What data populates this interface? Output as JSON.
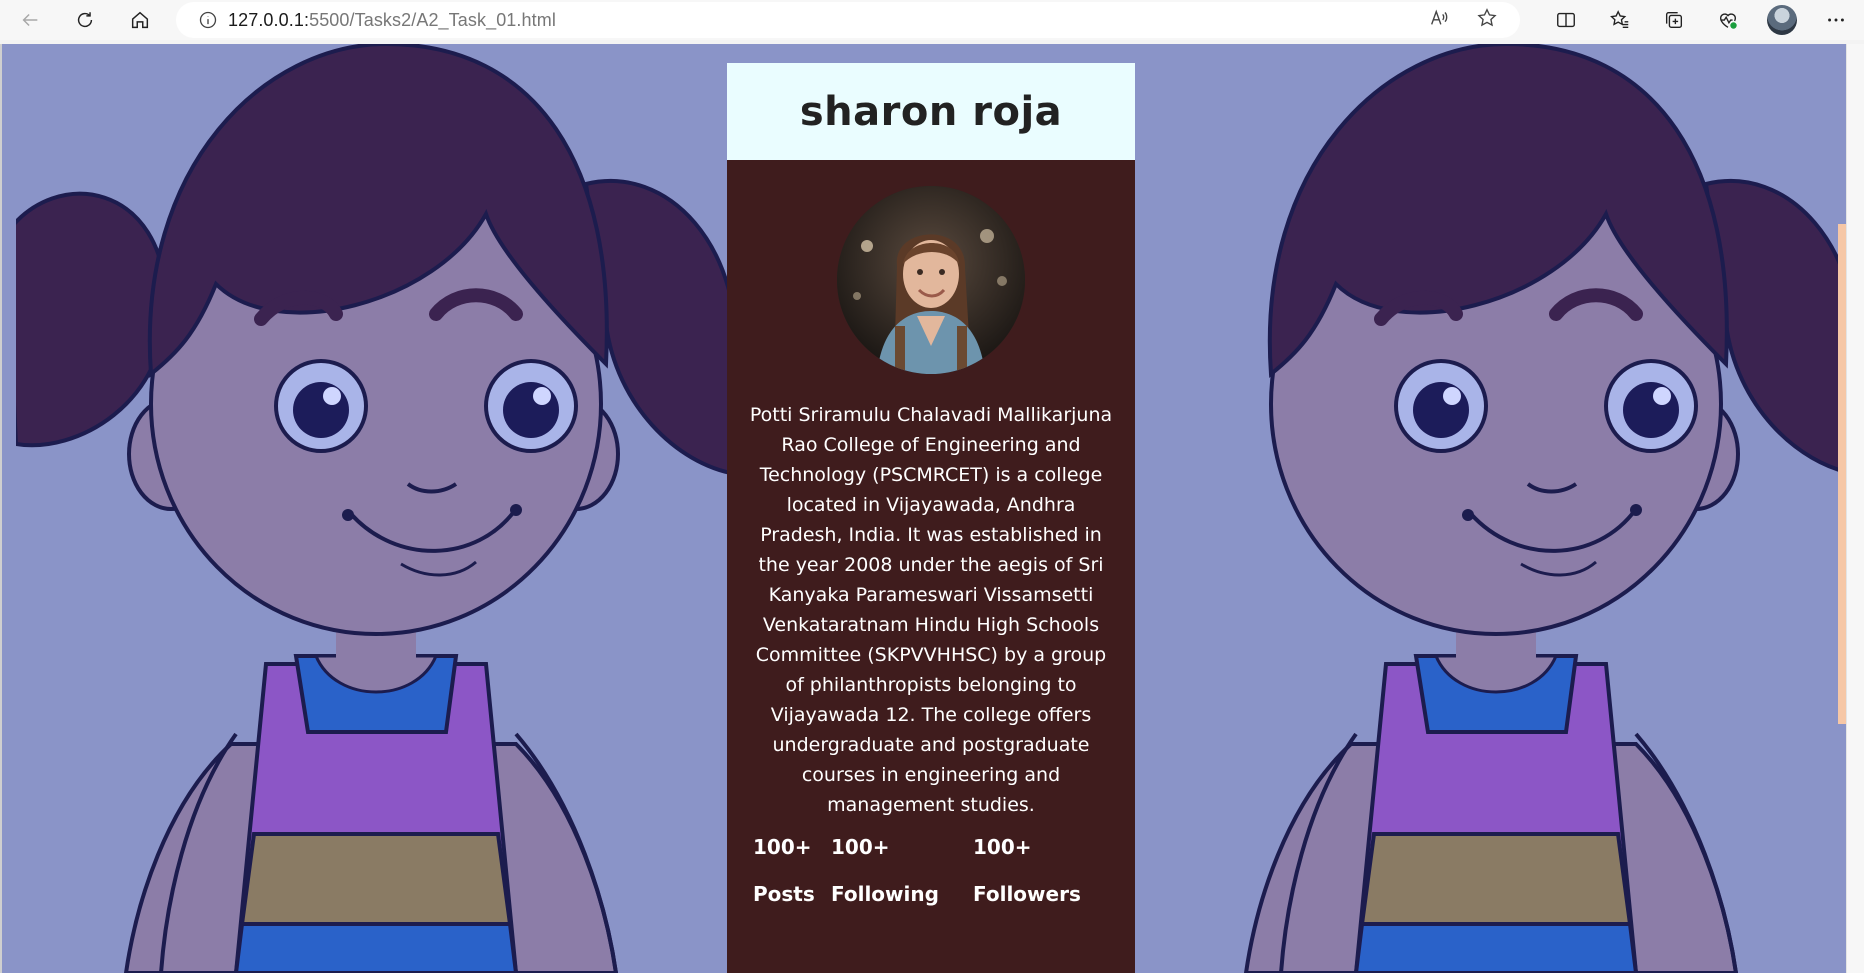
{
  "browser": {
    "url_host": "127.0.0.1:",
    "url_rest": "5500/Tasks2/A2_Task_01.html",
    "icons": [
      "back-icon",
      "refresh-icon",
      "home-icon",
      "info-icon",
      "read-aloud-icon",
      "favorite-star-icon",
      "split-screen-icon",
      "favorites-icon",
      "collections-icon",
      "browser-essentials-icon",
      "profile-avatar",
      "more-icon"
    ]
  },
  "profile": {
    "name": "sharon roja",
    "bio": "Potti Sriramulu Chalavadi Mallikarjuna Rao College of Engineering and Technology (PSCMRCET) is a college located in Vijayawada, Andhra Pradesh, India. It was established in the year 2008 under the aegis of Sri Kanyaka Parameswari Vissamsetti Venkataratnam Hindu High Schools Committee (SKPVVHHSC) by a group of philanthropists belonging to Vijayawada 12. The college offers undergraduate and postgraduate courses in engineering and management studies.",
    "stats": [
      {
        "value": "100+",
        "label": "Posts"
      },
      {
        "value": "100+",
        "label": "Following"
      },
      {
        "value": "100+",
        "label": "Followers"
      }
    ]
  },
  "colors": {
    "background": "#8a94c8",
    "card_body": "#3f1c1d",
    "card_header": "#eafdff"
  }
}
